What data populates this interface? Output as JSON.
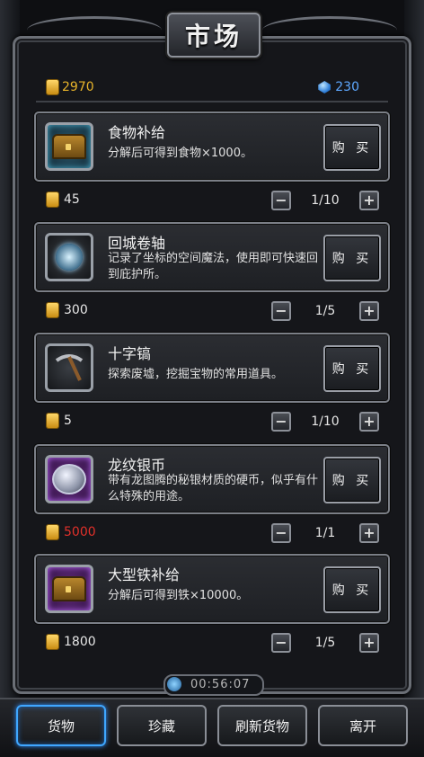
{
  "title": "市场",
  "currency": {
    "gold": "2970",
    "gems": "230"
  },
  "items": [
    {
      "name": "食物补给",
      "desc": "分解后可得到食物×1000。",
      "icon": "treasure-chest-icon",
      "buy_label": "购 买",
      "price": "45",
      "price_color": "#e6e6e6",
      "qty": "1/10",
      "rarity_color": "#4fb6d6"
    },
    {
      "name": "回城卷轴",
      "desc": "记录了坐标的空间魔法，使用即可快速回到庇护所。",
      "icon": "magic-scroll-icon",
      "buy_label": "购 买",
      "price": "300",
      "price_color": "#e6e6e6",
      "qty": "1/5",
      "rarity_color": "#9aa0a8"
    },
    {
      "name": "十字镐",
      "desc": "探索废墟，挖掘宝物的常用道具。",
      "icon": "pickaxe-icon",
      "buy_label": "购 买",
      "price": "5",
      "price_color": "#e6e6e6",
      "qty": "1/10",
      "rarity_color": "#9aa0a8"
    },
    {
      "name": "龙纹银币",
      "desc": "带有龙图腾的秘银材质的硬币，似乎有什么特殊的用途。",
      "icon": "silver-coin-icon",
      "buy_label": "购 买",
      "price": "5000",
      "price_color": "#e0302a",
      "qty": "1/1",
      "rarity_color": "#c06aff"
    },
    {
      "name": "大型铁补给",
      "desc": "分解后可得到铁×10000。",
      "icon": "treasure-chest-icon",
      "buy_label": "购 买",
      "price": "1800",
      "price_color": "#e6e6e6",
      "qty": "1/5",
      "rarity_color": "#c06aff"
    }
  ],
  "stepper": {
    "minus": "−",
    "plus": "+"
  },
  "timer": "00:56:07",
  "nav": {
    "goods": "货物",
    "treasures": "珍藏",
    "refresh": "刷新货物",
    "leave": "离开"
  }
}
